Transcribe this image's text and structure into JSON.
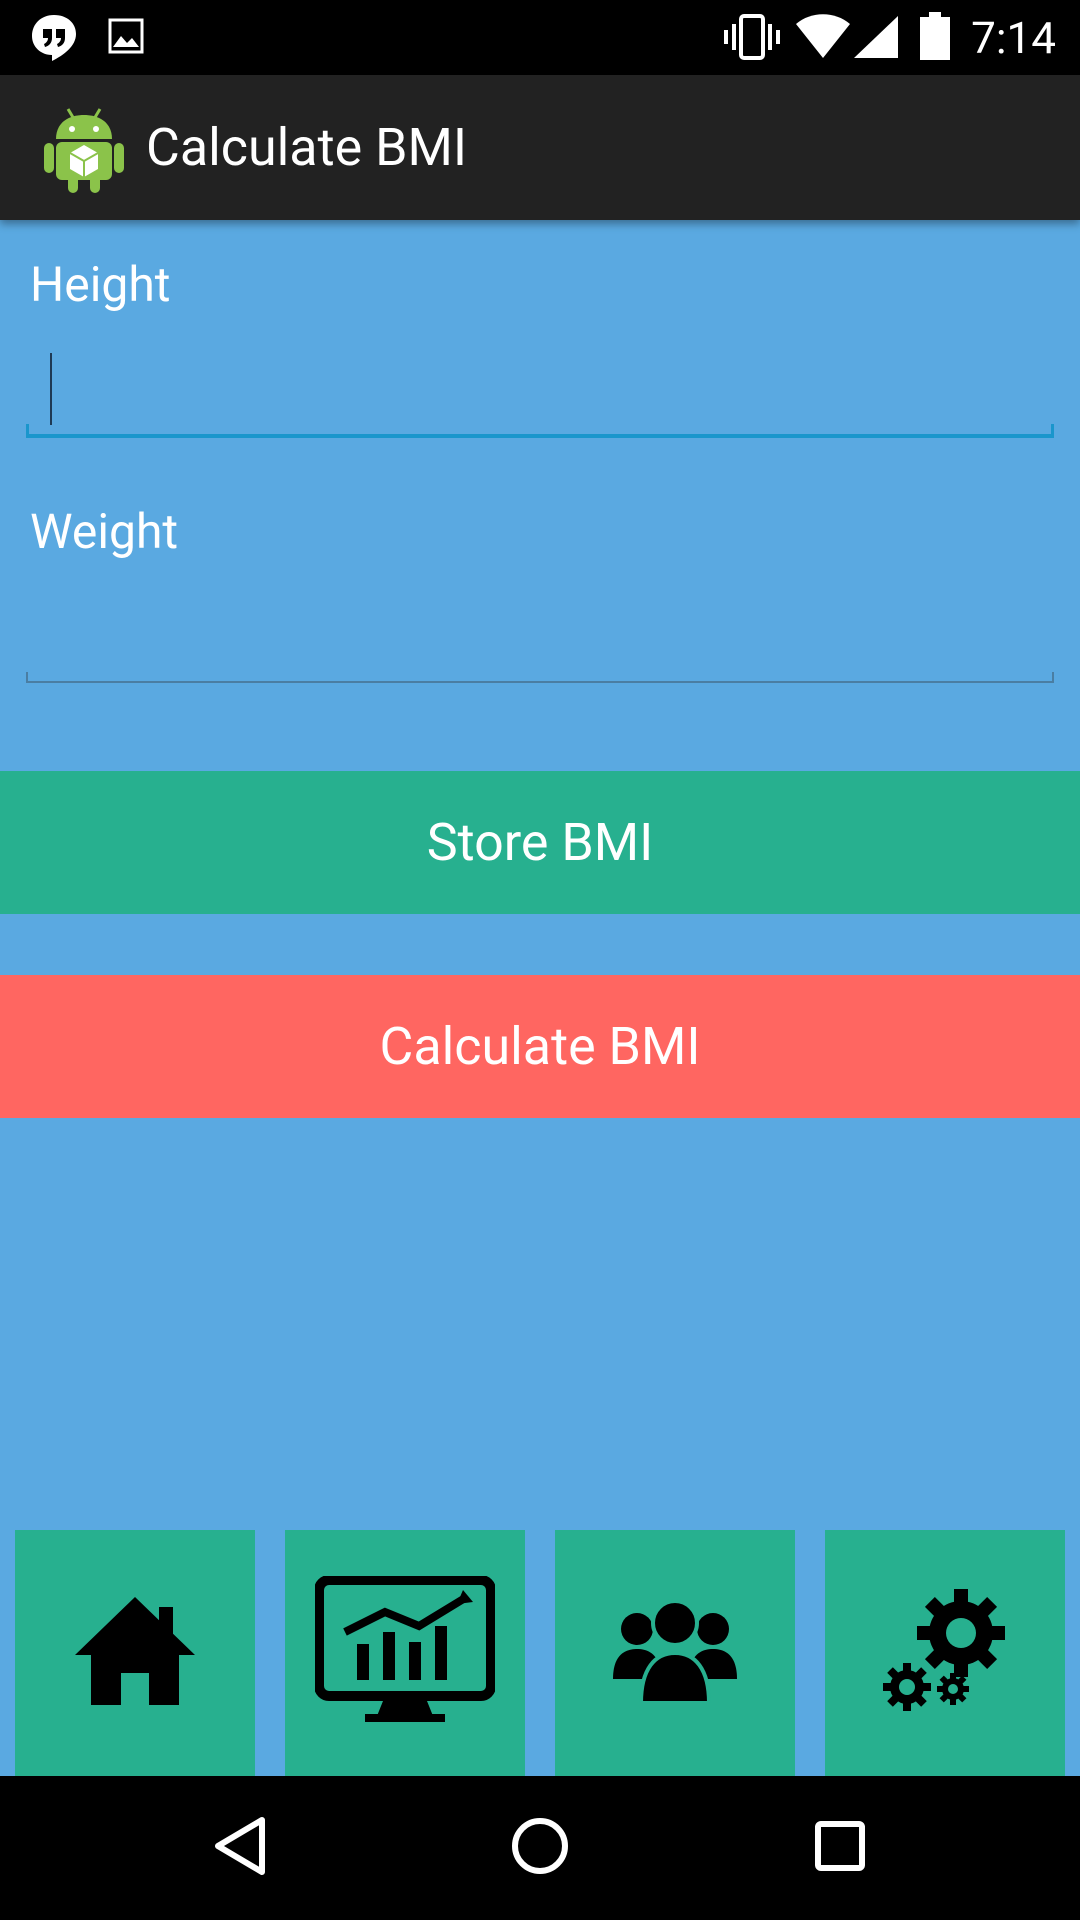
{
  "status_bar": {
    "time": "7:14",
    "icons": [
      "hangouts-icon",
      "image-icon",
      "vibrate-icon",
      "wifi-icon",
      "signal-icon",
      "battery-icon"
    ]
  },
  "action_bar": {
    "title": "Calculate BMI",
    "logo_icon": "android-icon"
  },
  "form": {
    "height_label": "Height",
    "height_value": "",
    "weight_label": "Weight",
    "weight_value": ""
  },
  "buttons": {
    "store_label": "Store BMI",
    "calculate_label": "Calculate BMI"
  },
  "bottom_tiles": [
    "home-icon",
    "analytics-monitor-icon",
    "users-icon",
    "settings-gears-icon"
  ],
  "nav_bar": [
    "back-icon",
    "home-circle-icon",
    "recents-icon"
  ],
  "colors": {
    "background": "#5aa9e1",
    "store_button": "#27b08f",
    "calculate_button": "#ff6661",
    "action_bar": "#222222",
    "input_focus": "#1a96cc"
  }
}
